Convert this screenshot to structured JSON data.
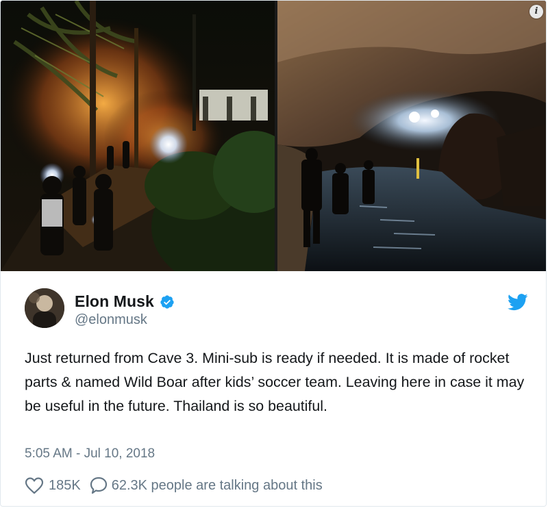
{
  "tweet": {
    "author": {
      "display_name": "Elon Musk",
      "handle": "@elonmusk",
      "verified": true,
      "verified_icon": "verified-badge-icon",
      "avatar": "avatar-photo"
    },
    "text": "Just returned from Cave 3. Mini-sub is ready if needed. It is made of rocket parts & named Wild Boar after kids’ soccer team. Leaving here in case it may be useful in the future. Thailand is so beautiful.",
    "timestamp": "5:05 AM - Jul 10, 2018",
    "likes": "185K",
    "talking_about": "62.3K people are talking about this",
    "info_badge_label": "i",
    "icons": {
      "brand": "twitter-bird-icon",
      "like": "heart-icon",
      "reply": "speech-bubble-icon",
      "info": "info-icon"
    }
  },
  "media": {
    "left_photo": "night-camp-photo",
    "right_photo": "cave-interior-photo"
  },
  "colors": {
    "brand": "#1da1f2",
    "text": "#14171a",
    "secondary_text": "#657786",
    "border": "#e1e8ed"
  }
}
